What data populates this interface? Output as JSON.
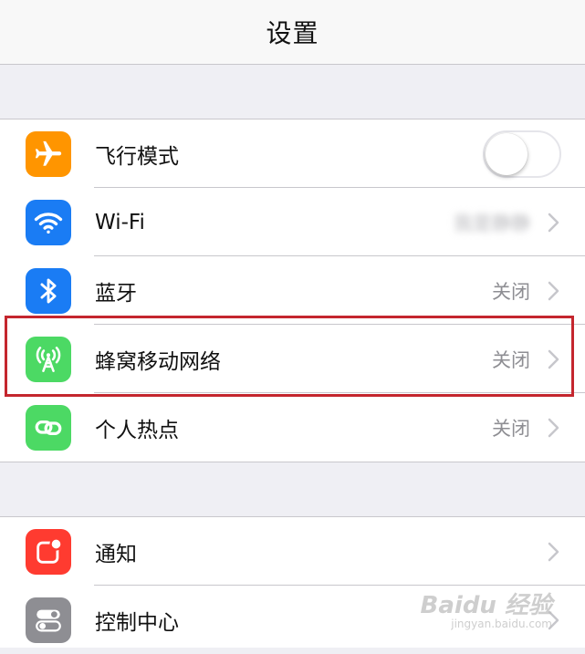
{
  "nav": {
    "title": "设置"
  },
  "group1": [
    {
      "key": "airplane",
      "label": "飞行模式",
      "icon": "airplane-icon",
      "icon_color": "#ff9500",
      "control": "toggle",
      "toggle_on": false
    },
    {
      "key": "wifi",
      "label": "Wi-Fi",
      "value": "我是静静",
      "icon": "wifi-icon",
      "icon_color": "#1a7cf4",
      "control": "chevron"
    },
    {
      "key": "bluetooth",
      "label": "蓝牙",
      "value": "关闭",
      "icon": "bluetooth-icon",
      "icon_color": "#1a7cf4",
      "control": "chevron"
    },
    {
      "key": "cellular",
      "label": "蜂窝移动网络",
      "value": "关闭",
      "icon": "cellular-antenna-icon",
      "icon_color": "#4cd964",
      "control": "chevron",
      "highlighted": true
    },
    {
      "key": "hotspot",
      "label": "个人热点",
      "value": "关闭",
      "icon": "hotspot-chain-icon",
      "icon_color": "#4cd964",
      "control": "chevron"
    }
  ],
  "group2": [
    {
      "key": "notifications",
      "label": "通知",
      "icon": "notifications-icon",
      "icon_color": "#ff3b30",
      "control": "chevron"
    },
    {
      "key": "control_center",
      "label": "控制中心",
      "icon": "control-center-icon",
      "icon_color": "#8e8e93",
      "control": "chevron"
    }
  ],
  "highlight_color": "#c4262e",
  "watermark": {
    "main": "Baidu 经验",
    "sub": "jingyan.baidu.com"
  }
}
